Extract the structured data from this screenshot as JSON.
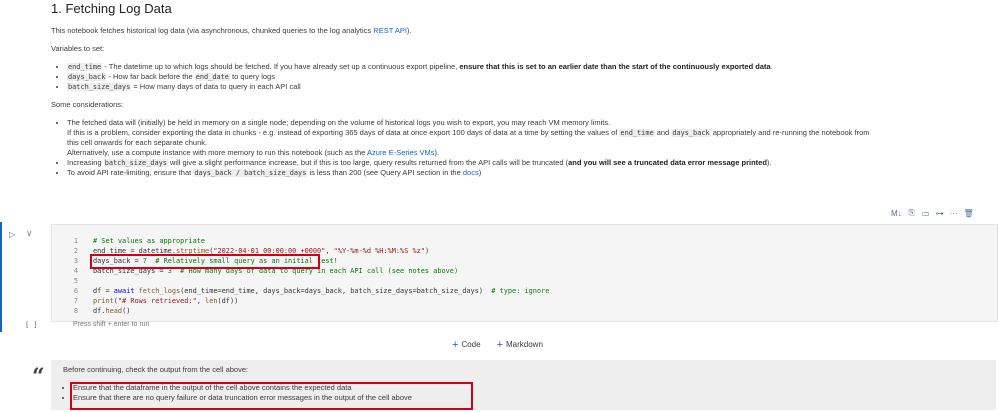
{
  "heading": "1. Fetching Log Data",
  "intro": {
    "before_link": "This notebook fetches historical log data (via asynchronous, chunked queries to the log analytics ",
    "link": "REST API",
    "after_link": ")."
  },
  "variables_label": "Variables to set:",
  "variables": [
    {
      "code": "end_time",
      "text": " - The datetime up to which logs should be fetched. If you have already set up a continuous export pipeline, ",
      "bold": "ensure that this is set to an earlier date than the start of the continuously exported data",
      "tail": "."
    },
    {
      "code": "days_back",
      "text": " - How far back before the ",
      "code2": "end_date",
      "tail": " to query logs"
    },
    {
      "code": "batch_size_days",
      "text": " = How many days of data to query in each API call"
    }
  ],
  "considerations_label": "Some considerations:",
  "considerations": {
    "c1_line1": "The fetched data will (initially) be held in memory on a single node; depending on the volume of historical logs you wish to export, you may reach VM memory limits.",
    "c1_line2_a": "If this is a problem, consider exporting the data in chunks - e.g. instead of exporting 365 days of data at once export 100 days of data at a time by setting the values of ",
    "c1_line2_code1": "end_time",
    "c1_line2_b": " and ",
    "c1_line2_code2": "days_back",
    "c1_line2_c": " appropriately and re-running the notebook from",
    "c1_line3": "this cell onwards for each separate chunk.",
    "c1_line4_a": "Alternatively, use a compute instance with more memory to run this notebook (such as the ",
    "c1_line4_link": "Azure E-Series VMs",
    "c1_line4_b": ").",
    "c2_a": "Increasing ",
    "c2_code": "batch_size_days",
    "c2_b": " will give a slight performance increase, but if this is too large, query results returned from the API calls will be truncated (",
    "c2_bold": "and you will see a truncated data error message printed",
    "c2_c": ").",
    "c3_a": "To avoid API rate-limiting, ensure that ",
    "c3_code": "days_back / batch_size_days",
    "c3_b": " is less than 200 (see Query API section in the ",
    "c3_link": "docs",
    "c3_c": ")"
  },
  "toolbar": {
    "ml": "M↓",
    "split": "⎘",
    "comment": "▭",
    "split_cell": "⊶",
    "more": "···",
    "delete": "🗑"
  },
  "code_cell": {
    "run_icon": "▷",
    "collapse_icon": "∨",
    "exec_count": "[ ]",
    "lines": [
      {
        "n": "1",
        "parts": [
          [
            "cm",
            "# Set values as appropriate"
          ]
        ]
      },
      {
        "n": "2",
        "parts": [
          [
            "",
            "end_time = datetime."
          ],
          [
            "fn",
            "strptime"
          ],
          [
            "",
            "("
          ],
          [
            "st",
            "\"2022-04-01 00:00:00 +0000\""
          ],
          [
            "",
            ", "
          ],
          [
            "st",
            "\"%Y-%m-%d %H:%M:%S %z\""
          ],
          [
            "",
            ")"
          ]
        ]
      },
      {
        "n": "3",
        "parts": [
          [
            "",
            "days_back = "
          ],
          [
            "nm",
            "7"
          ],
          [
            "",
            "  "
          ],
          [
            "cm",
            "# Relatively small query as an initial test!"
          ]
        ]
      },
      {
        "n": "4",
        "parts": [
          [
            "",
            "batch_size_days = "
          ],
          [
            "nm",
            "3"
          ],
          [
            "",
            "  "
          ],
          [
            "cm",
            "# How many days of data to query in each API call (see notes above)"
          ]
        ]
      },
      {
        "n": "5",
        "parts": [
          [
            "",
            ""
          ]
        ]
      },
      {
        "n": "6",
        "parts": [
          [
            "",
            "df = "
          ],
          [
            "kw",
            "await"
          ],
          [
            "",
            " "
          ],
          [
            "fn",
            "fetch_logs"
          ],
          [
            "",
            "(end_time=end_time, days_back=days_back, batch_size_days=batch_size_days)  "
          ],
          [
            "cm",
            "# type: ignore"
          ]
        ]
      },
      {
        "n": "7",
        "parts": [
          [
            "fn",
            "print"
          ],
          [
            "",
            "("
          ],
          [
            "st",
            "\"# Rows retrieved:\""
          ],
          [
            "",
            ", "
          ],
          [
            "fn",
            "len"
          ],
          [
            "",
            "(df))"
          ]
        ]
      },
      {
        "n": "8",
        "parts": [
          [
            "",
            "df."
          ],
          [
            "fn",
            "head"
          ],
          [
            "",
            "()"
          ]
        ]
      }
    ],
    "hint": "Press shift + enter to run"
  },
  "add_buttons": {
    "code": "Code",
    "markdown": "Markdown"
  },
  "quote": {
    "intro": "Before continuing, check the output from the cell above:",
    "items": [
      "Ensure that the dataframe in the output of the cell above contains the expected data",
      "Ensure that there are no query failure or data truncation error messages in the output of the cell above"
    ]
  },
  "colors": {
    "accent": "#1565c0",
    "highlight": "#d0021b"
  }
}
